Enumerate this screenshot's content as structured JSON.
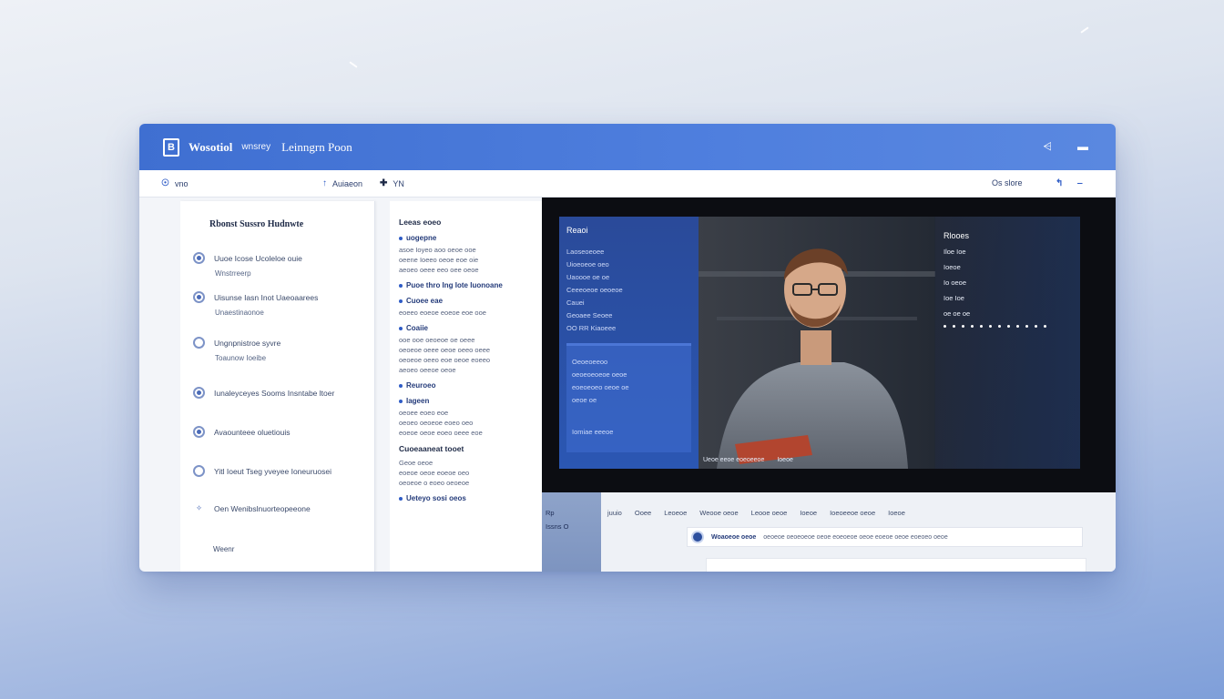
{
  "window": {
    "app_name": "Wosotiol",
    "app_subtitle": "wnsrey",
    "room_title": "Leinngrn Poon",
    "logo_letter": "B",
    "title_icons": [
      "chart-icon",
      "window-icon"
    ]
  },
  "toolbar": {
    "left_label": "vno",
    "center_items": [
      {
        "icon": "pointer-icon",
        "label": "Auiaeon"
      },
      {
        "icon": "pin-icon",
        "label": "YN"
      }
    ],
    "right_label": "Os slore",
    "right_icons": [
      "share-icon",
      "more-icon"
    ]
  },
  "left_panel": {
    "title": "Rbonst Sussro Hudnwte",
    "items": [
      {
        "label": "Uuoe Icose Ucoleloe ouie",
        "sub": "Wnstrreerp"
      },
      {
        "label": "Uisunse Iasn Inot Uaeoaarees",
        "sub": "Unaestinaonoe"
      },
      {
        "label": "Ungnpnistroe syvre",
        "sub": "Toaunow Ioeibe"
      },
      {
        "label": "Iunaleyceyes  Sooms  Insntabe ltoer",
        "sub": ""
      },
      {
        "label": "Avaounteee oluetiouis",
        "sub": ""
      },
      {
        "label": "Yitl Ioeut Tseg yveyee Ioneuruosei",
        "sub": ""
      },
      {
        "label": "Oen  Wenibslnuorteopeeone",
        "sub": ""
      }
    ],
    "footer": "Weenr"
  },
  "mid_panel": {
    "header": "Leeas eoeo",
    "sections": [
      {
        "title": "uogepne",
        "lines": [
          "asoe Ioyeo aoo oeoe ooe",
          "oeene Ioeeo oeoe eoe oie",
          "aeoeo oeee eeo oee oeoe"
        ]
      },
      {
        "title": "Puoe thro Ing Iote Iuonoane",
        "lines": []
      },
      {
        "title": "Cuoee eae",
        "lines": [
          "eoeeo eoeoe eoeoe eoe ooe"
        ]
      },
      {
        "title": "Coaiie",
        "lines": [
          "ooe ooe oeoeoe oe oeee",
          "oeoeoe oeee oeoe oeeo oeee",
          "oeoeoe oeeo eoe oeoe eoeeo",
          "aeoeo oeeoe oeoe"
        ]
      },
      {
        "title": "Reuroeo",
        "lines": []
      },
      {
        "title": "Iageen",
        "lines": [
          "oeoee eoeo eoe",
          "oeoeo oeoeoe eoeo oeo",
          "eoeoe oeoe eoeo oeee eoe"
        ]
      }
    ],
    "callout_title": "Cuoeaaneat tooet",
    "callout_lines": [
      "Geoe oeoe",
      "eoeoe oeoe eoeoe oeo",
      "oeoeoe o eoeo oeoeoe"
    ],
    "footer_bullet": "Ueteyo sosi oeos"
  },
  "video": {
    "left_header": "Reaoi",
    "left_lines": [
      "Laoseoeoee",
      "Uioeoeoe oeo",
      "Uaoooe oe oe",
      "Ceeeoeoe oeoeoe",
      "Cauei"
    ],
    "left_item": "Geoaee Seoee",
    "left_item2": "OO  RR  Kiaoeee",
    "box_title": "Oeoeoeeoo",
    "box_lines": [
      "oeoeoeoeoe oeoe",
      "eoeoeoeo oeoe oe",
      "oeoe oe"
    ],
    "box_footer": "Iomiae eeeoe",
    "right_header": "Rlooes",
    "right_lines": [
      "Iloe   Ioe",
      "Ioeoe",
      "Io oeoe",
      "Ioe Ioe",
      "oe oe oe"
    ],
    "caption_left": "Ueoe eeoe eoeoeeoe",
    "caption_right": "Ioeoe"
  },
  "bottom": {
    "left_label": "Rp",
    "left_sub": "Issns O",
    "tabs": [
      "juuio",
      "Ooee",
      "Leoeoe",
      "Weooe oeoe",
      "Leooe oeoe",
      "Ioeoe",
      "Ioeoeeoe oeoe",
      "Ioeoe"
    ],
    "message_author": "Woaoeoe oeoe",
    "message_text": "oeoeoe oeoeoeoe oeoe eoeoeoe oeoe eoeoe oeoe eoeoeo oeoe"
  },
  "colors": {
    "brand": "#4575d9",
    "accent_dark": "#243b7a",
    "video_bg": "#0c0d12"
  }
}
